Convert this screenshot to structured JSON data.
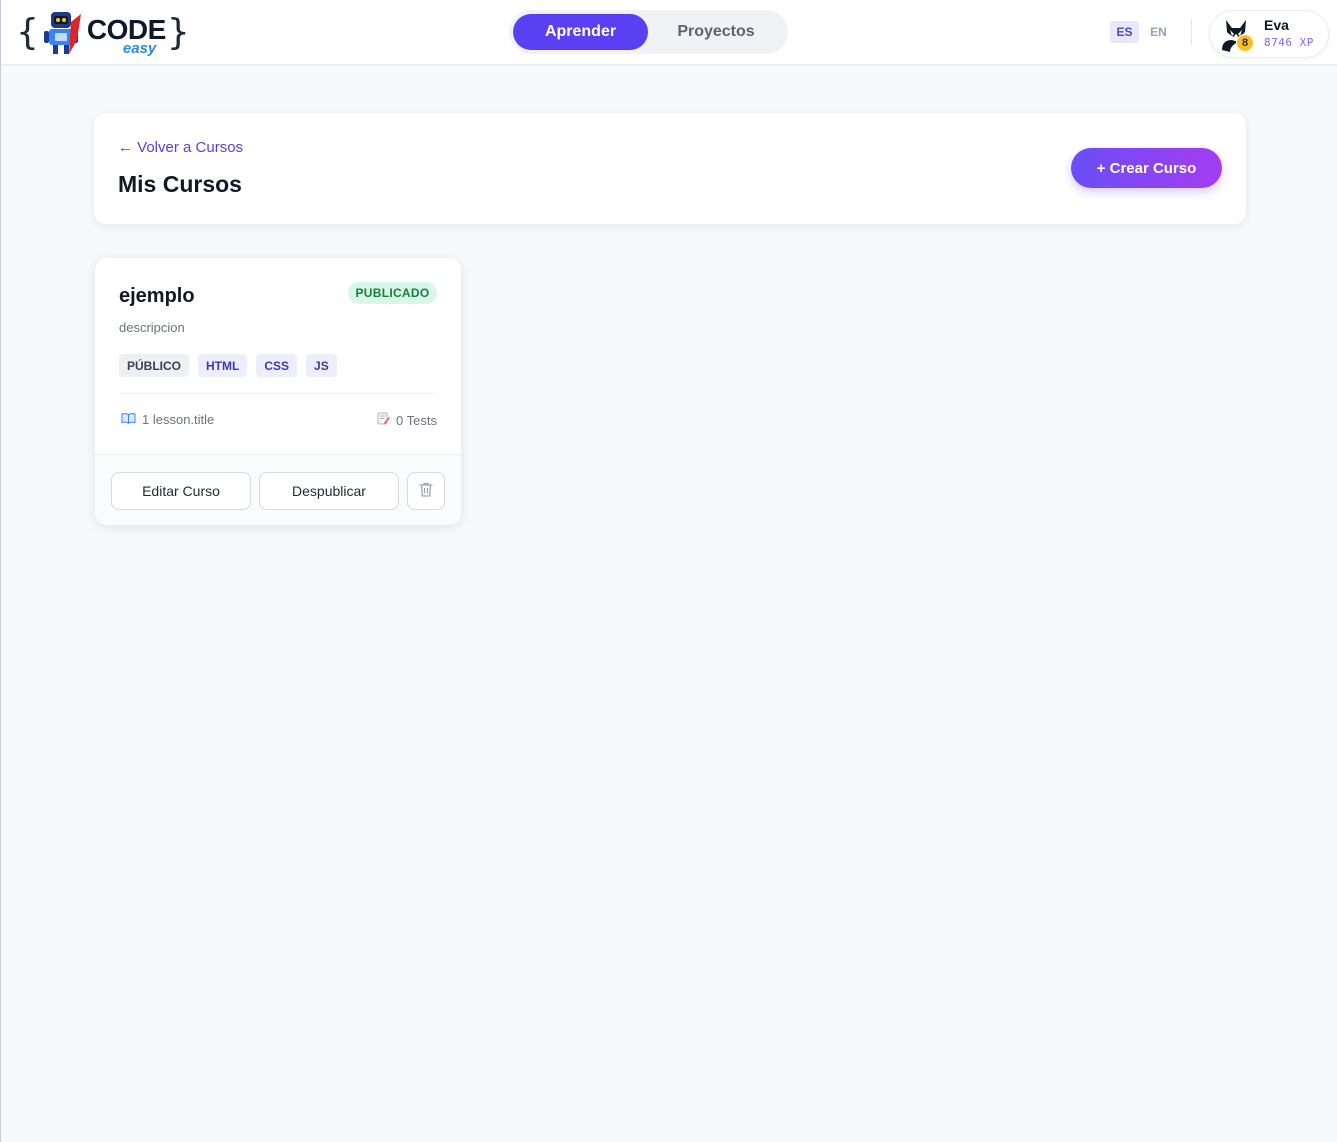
{
  "header": {
    "logo": {
      "word": "CODE",
      "sub": "easy",
      "brace_open": "{",
      "brace_close": "}"
    },
    "tabs": [
      {
        "label": "Aprender",
        "active": true
      },
      {
        "label": "Proyectos",
        "active": false
      }
    ],
    "languages": [
      {
        "code": "ES",
        "active": true
      },
      {
        "code": "EN",
        "active": false
      }
    ],
    "user": {
      "name": "Eva",
      "level": "8",
      "xp": "8746 XP",
      "avatar_icon": "fox-avatar-icon"
    }
  },
  "page": {
    "back_link": "← Volver a Cursos",
    "title": "Mis Cursos",
    "create_button": "+ Crear Curso"
  },
  "courses": [
    {
      "title": "ejemplo",
      "status": "PUBLICADO",
      "description": "descripcion",
      "visibility": "PÚBLICO",
      "tags": [
        "HTML",
        "CSS",
        "JS"
      ],
      "lessons": "1 lesson.title",
      "lessons_icon": "book-icon",
      "tests": "0 Tests",
      "tests_icon": "memo-icon",
      "edit_button": "Editar Curso",
      "unpublish_button": "Despublicar",
      "delete_icon": "trash-icon"
    }
  ],
  "colors": {
    "primary": "#5b3ff2",
    "gradient_start": "#6a4ef6",
    "gradient_end": "#a53cf0",
    "published_bg": "#d8f7e6",
    "published_text": "#15803d",
    "page_bg": "#f8f9fb"
  }
}
